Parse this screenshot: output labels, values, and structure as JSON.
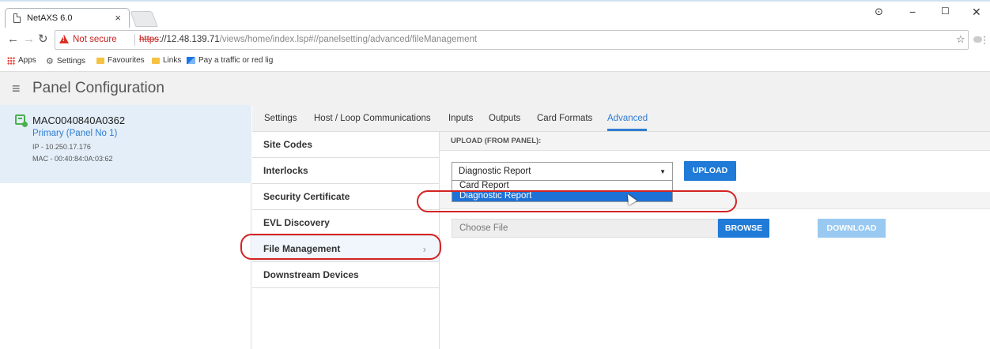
{
  "browser": {
    "tab_title": "NetAXS 6.0",
    "tab_close": "×",
    "not_secure": "Not secure",
    "url_scheme": "https",
    "url_host": "://12.48.139.71",
    "url_path": "/views/home/index.lsp#//panelsetting/advanced/fileManagement",
    "bookmarks": [
      "Apps",
      "Settings",
      "Favourites",
      "Links",
      "Pay a traffic or red lig"
    ],
    "window_controls": [
      "−",
      "☐",
      "✕"
    ]
  },
  "app": {
    "title": "Panel Configuration",
    "panel": {
      "name": "MAC0040840A0362",
      "primary": "Primary (Panel No 1)",
      "ip": "IP - 10.250.17.176",
      "mac": "MAC - 00:40:84:0A:03:62"
    },
    "tabs": [
      {
        "label": "Settings",
        "active": false
      },
      {
        "label": "Host / Loop Communications",
        "active": false
      },
      {
        "label": "Inputs",
        "active": false
      },
      {
        "label": "Outputs",
        "active": false
      },
      {
        "label": "Card Formats",
        "active": false
      },
      {
        "label": "Advanced",
        "active": true
      }
    ],
    "menu": [
      {
        "label": "Site Codes"
      },
      {
        "label": "Interlocks"
      },
      {
        "label": "Security Certificate"
      },
      {
        "label": "EVL Discovery"
      },
      {
        "label": "File Management",
        "selected": true
      },
      {
        "label": "Downstream Devices"
      }
    ],
    "upload": {
      "heading": "UPLOAD (FROM PANEL):",
      "selected": "Diagnostic Report",
      "options": [
        "Card Report",
        "Diagnostic Report"
      ],
      "highlighted_option": "Diagnostic Report",
      "button": "UPLOAD"
    },
    "download": {
      "file_placeholder": "Choose File",
      "browse": "BROWSE",
      "download": "DOWNLOAD"
    }
  },
  "colors": {
    "accent": "#1f7ad8",
    "annotation": "#d42323",
    "disabled_button": "#99c9f1"
  }
}
